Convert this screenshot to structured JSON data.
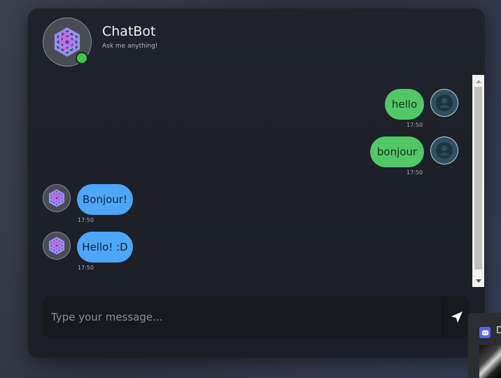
{
  "header": {
    "title": "ChatBot",
    "subtitle": "Ask me anything!",
    "status": "online",
    "avatar_icon": "openai-logo-icon"
  },
  "messages": [
    {
      "sender": "user",
      "text": "hello",
      "time": "17:50"
    },
    {
      "sender": "user",
      "text": "bonjour",
      "time": "17:50"
    },
    {
      "sender": "bot",
      "text": "Bonjour!",
      "time": "17:50"
    },
    {
      "sender": "bot",
      "text": "Hello! :D",
      "time": "17:50"
    }
  ],
  "input": {
    "placeholder": "Type your message...",
    "value": "",
    "send_icon": "send-icon"
  },
  "taskbar_preview": {
    "label": "D",
    "icon": "discord-icon"
  },
  "colors": {
    "user_bubble": "#52c766",
    "bot_bubble": "#4ea6f8",
    "online": "#3cc84a",
    "card_bg": "#1f222b"
  }
}
